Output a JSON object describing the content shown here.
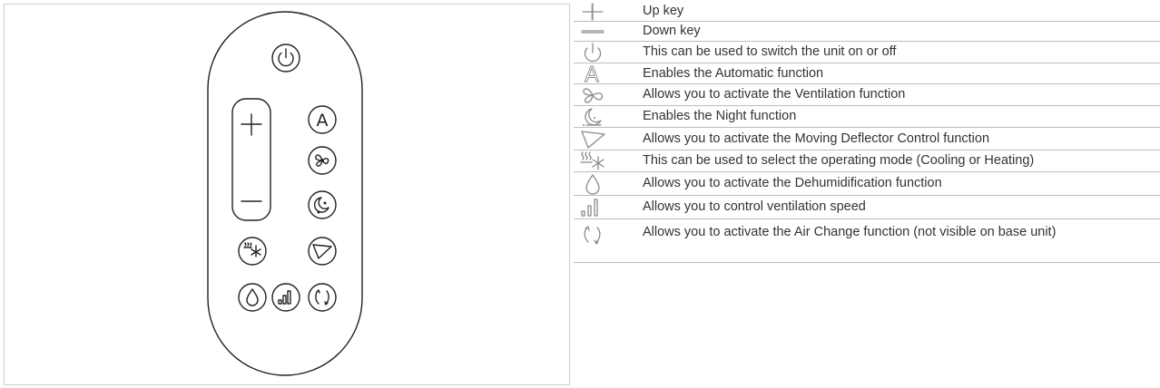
{
  "legend": [
    {
      "icon": "plus-icon",
      "text": "Up key"
    },
    {
      "icon": "minus-icon",
      "text": "Down key"
    },
    {
      "icon": "power-icon",
      "text": "This can be used to switch the unit on or off"
    },
    {
      "icon": "auto-icon",
      "text": "Enables the Automatic function",
      "glyph": "A"
    },
    {
      "icon": "fan-icon",
      "text": "Allows you to activate the Ventilation function"
    },
    {
      "icon": "night-icon",
      "text": "Enables the Night function"
    },
    {
      "icon": "deflector-icon",
      "text": "Allows you to activate the Moving Deflector Control function"
    },
    {
      "icon": "mode-icon",
      "text": "This can be used to select the operating mode (Cooling or Heating)"
    },
    {
      "icon": "drop-icon",
      "text": "Allows you to activate the Dehumidification function"
    },
    {
      "icon": "speed-icon",
      "text": "Allows you to control ventilation speed"
    },
    {
      "icon": "air-change-icon",
      "text": "Allows you to activate the Air Change function (not visible on base unit)"
    }
  ],
  "remote": {
    "auto_glyph": "A"
  },
  "colors": {
    "line": "#222222",
    "legend_icon": "#8a8a8a",
    "border": "#bdbdbd",
    "text": "#333333"
  }
}
